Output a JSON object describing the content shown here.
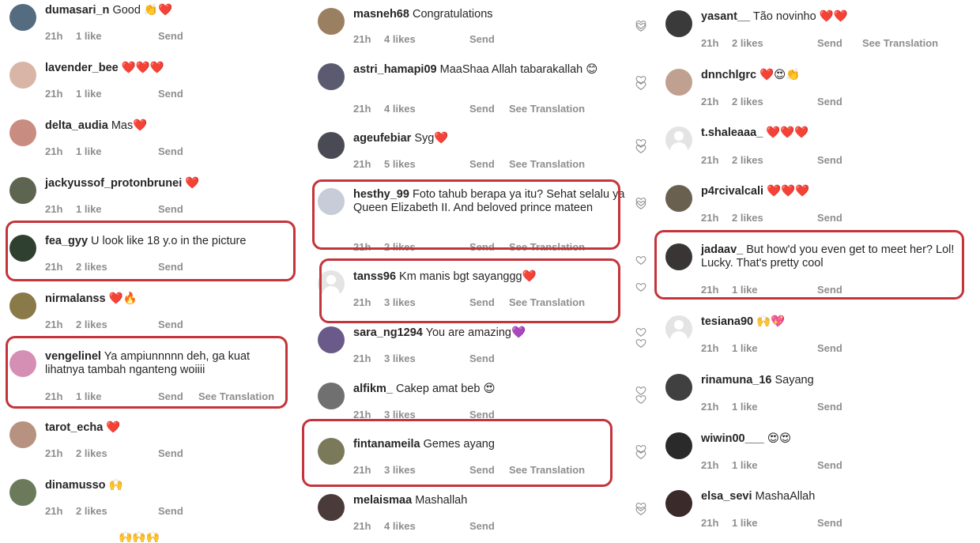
{
  "col1": [
    {
      "username": "dumasari_n",
      "text": "Good 👏❤️",
      "time": "21h",
      "likes": "1 like",
      "send": "Send",
      "avatar": "#556b7f"
    },
    {
      "username": "lavender_bee",
      "text": "❤️❤️❤️",
      "time": "21h",
      "likes": "1 like",
      "send": "Send",
      "avatar": "#d8b5a6"
    },
    {
      "username": "delta_audia",
      "text": "Mas❤️",
      "time": "21h",
      "likes": "1 like",
      "send": "Send",
      "avatar": "#c98c80"
    },
    {
      "username": "jackyussof_protonbrunei",
      "text": "❤️",
      "time": "21h",
      "likes": "1 like",
      "send": "Send",
      "avatar": "#5d6550"
    },
    {
      "username": "fea_gyy",
      "text": "U look like 18 y.o  in the picture",
      "time": "21h",
      "likes": "2 likes",
      "send": "Send",
      "avatar": "#2f4030"
    },
    {
      "username": "nirmalanss",
      "text": "❤️🔥",
      "time": "21h",
      "likes": "2 likes",
      "send": "Send",
      "avatar": "#8a7a4a"
    },
    {
      "username": "vengelinel",
      "text": "Ya ampiunnnnn deh, ga kuat lihatnya tambah nganteng woiiii",
      "time": "21h",
      "likes": "1 like",
      "send": "Send",
      "translate": "See Translation",
      "avatar": "#d68fb4"
    },
    {
      "username": "tarot_echa",
      "text": "❤️",
      "time": "21h",
      "likes": "2 likes",
      "send": "Send",
      "avatar": "#b89280"
    },
    {
      "username": "dinamusso",
      "text": "🙌",
      "time": "21h",
      "likes": "2 likes",
      "send": "Send",
      "avatar": "#6b7a5a"
    }
  ],
  "col2": [
    {
      "username": "masneh68",
      "text": "Congratulations",
      "time": "21h",
      "likes": "4 likes",
      "send": "Send",
      "avatar": "#9a8060"
    },
    {
      "username": "astri_hamapi09",
      "text": "MaaShaa Allah tabarakallah 😊",
      "time": "21h",
      "likes": "4 likes",
      "send": "Send",
      "translate": "See Translation",
      "avatar": "#5a5a70"
    },
    {
      "username": "ageufebiar",
      "text": "Syg❤️",
      "time": "21h",
      "likes": "5 likes",
      "send": "Send",
      "translate": "See Translation",
      "avatar": "#4a4a55"
    },
    {
      "username": "hesthy_99",
      "text": "Foto tahub berapa ya itu? Sehat selalu ya Queen Elizabeth  II. And beloved prince mateen",
      "time": "21h",
      "likes": "2 likes",
      "send": "Send",
      "translate": "See Translation",
      "avatar": "#c8ccd8"
    },
    {
      "username": "tanss96",
      "text": "Km manis bgt sayanggg❤️",
      "time": "21h",
      "likes": "3 likes",
      "send": "Send",
      "translate": "See Translation",
      "avatar": "default"
    },
    {
      "username": "sara_ng1294",
      "text": "You are amazing💜",
      "time": "21h",
      "likes": "3 likes",
      "send": "Send",
      "avatar": "#6a5a8a"
    },
    {
      "username": "alfikm_",
      "text": "Cakep amat beb 😍",
      "time": "21h",
      "likes": "3 likes",
      "send": "Send",
      "avatar": "#707070"
    },
    {
      "username": "fintanameila",
      "text": "Gemes ayang",
      "time": "21h",
      "likes": "3 likes",
      "send": "Send",
      "translate": "See Translation",
      "avatar": "#7a7a5a"
    },
    {
      "username": "melaismaa",
      "text": "Mashallah",
      "time": "21h",
      "likes": "4 likes",
      "send": "Send",
      "avatar": "#4a3a3a"
    }
  ],
  "col3": [
    {
      "username": "yasant__",
      "text": "Tão novinho ❤️❤️",
      "time": "21h",
      "likes": "2 likes",
      "send": "Send",
      "translate": "See Translation",
      "avatar": "#3a3a3a"
    },
    {
      "username": "dnnchlgrc",
      "text": "❤️😍👏",
      "time": "21h",
      "likes": "2 likes",
      "send": "Send",
      "avatar": "#c0a090"
    },
    {
      "username": "t.shaleaaa_",
      "text": "❤️❤️❤️",
      "time": "21h",
      "likes": "2 likes",
      "send": "Send",
      "avatar": "default"
    },
    {
      "username": "p4rcivalcali",
      "text": "❤️❤️❤️",
      "time": "21h",
      "likes": "2 likes",
      "send": "Send",
      "avatar": "#6a6050"
    },
    {
      "username": "jadaav_",
      "text": "But how'd you even get to meet her? Lol! Lucky. That's pretty cool",
      "time": "21h",
      "likes": "1 like",
      "send": "Send",
      "avatar": "#3a3535"
    },
    {
      "username": "tesiana90",
      "text": "🙌💖",
      "time": "21h",
      "likes": "1 like",
      "send": "Send",
      "avatar": "default"
    },
    {
      "username": "rinamuna_16",
      "text": "Sayang",
      "time": "21h",
      "likes": "1 like",
      "send": "Send",
      "avatar": "#404040"
    },
    {
      "username": "wiwin00___",
      "text": "😍😍",
      "time": "21h",
      "likes": "1 like",
      "send": "Send",
      "avatar": "#2a2a2a"
    },
    {
      "username": "elsa_sevi",
      "text": "MashaAllah",
      "time": "21h",
      "likes": "1 like",
      "send": "Send",
      "avatar": "#3a2a2a"
    }
  ],
  "partial_bottom": "🙌🙌🙌"
}
